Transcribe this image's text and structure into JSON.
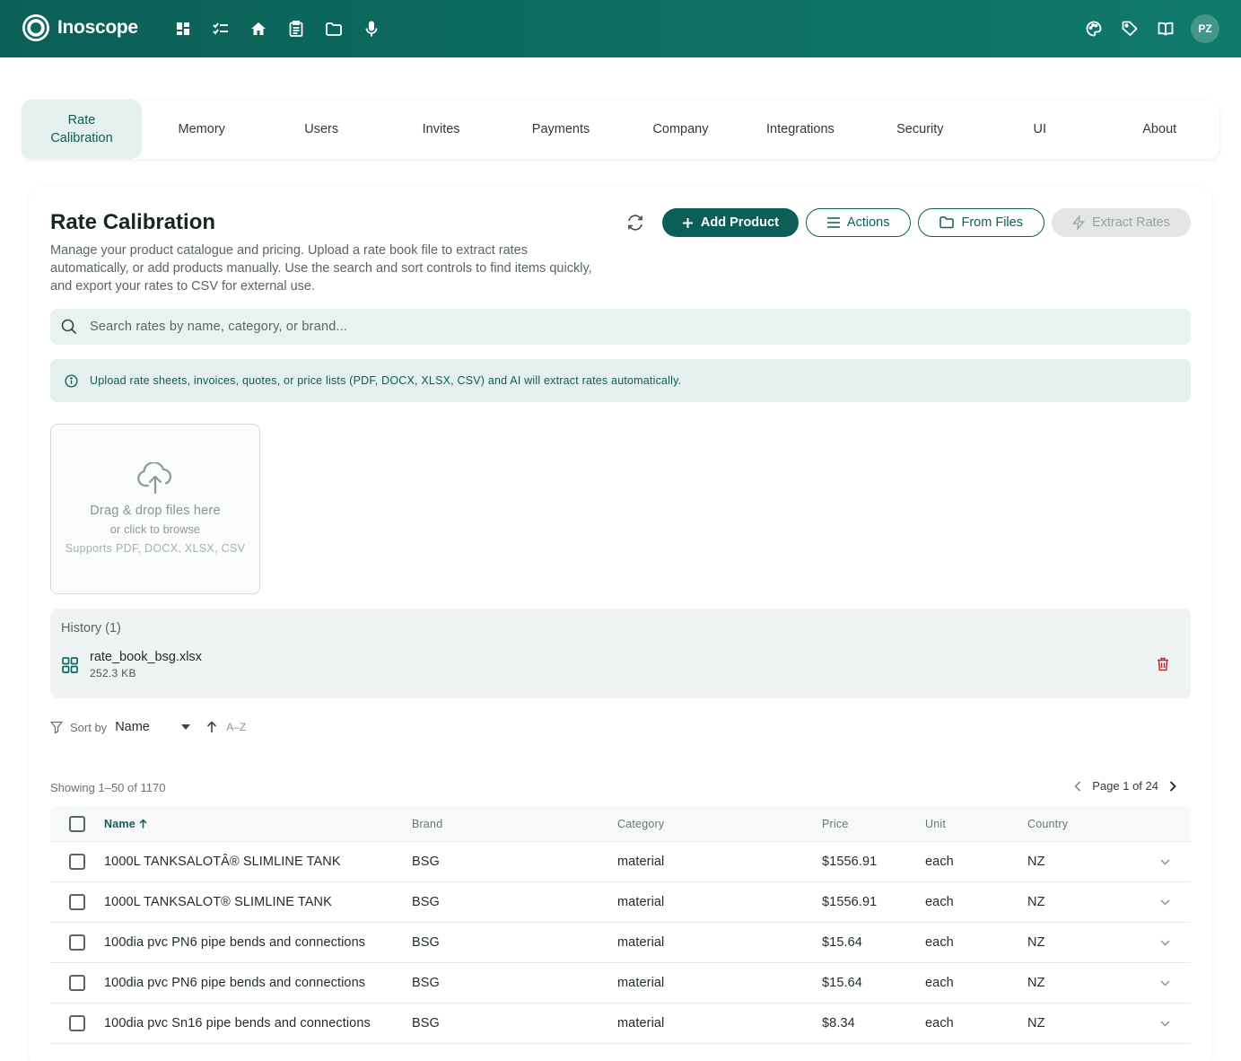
{
  "app": {
    "name": "Inoscope",
    "user_initials": "PZ",
    "accent_color": "#0b5f57",
    "nav_icons": [
      "dashboard-icon",
      "checklist-icon",
      "home-icon",
      "clipboard-icon",
      "folder-icon",
      "microphone-icon"
    ],
    "right_icons": [
      "palette-icon",
      "tag-icon",
      "book-icon"
    ]
  },
  "tabs": [
    {
      "label": "Rate Calibration",
      "active": true
    },
    {
      "label": "Memory"
    },
    {
      "label": "Users"
    },
    {
      "label": "Invites"
    },
    {
      "label": "Payments"
    },
    {
      "label": "Company"
    },
    {
      "label": "Integrations"
    },
    {
      "label": "Security"
    },
    {
      "label": "UI"
    },
    {
      "label": "About"
    }
  ],
  "page": {
    "title": "Rate Calibration",
    "description": "Manage your product catalogue and pricing. Upload a rate book file to extract rates automatically, or add products manually. Use the search and sort controls to find items quickly, and export your rates to CSV for external use."
  },
  "buttons": {
    "add_product": "Add Product",
    "actions": "Actions",
    "from_files": "From Files",
    "extract_rates": "Extract Rates"
  },
  "search": {
    "placeholder": "Search rates by name, category, or brand..."
  },
  "info_banner": "Upload rate sheets, invoices, quotes, or price lists (PDF, DOCX, XLSX, CSV) and AI will extract rates automatically.",
  "dropzone": {
    "title": "Drag & drop files here",
    "subtitle": "or click to browse",
    "supports": "Supports PDF, DOCX, XLSX, CSV"
  },
  "history": {
    "title": "History (1)",
    "files": [
      {
        "name": "rate_book_bsg.xlsx",
        "size": "252.3 KB"
      }
    ]
  },
  "sort": {
    "label": "Sort by",
    "field": "Name",
    "direction": "A–Z"
  },
  "pagination": {
    "showing": "Showing 1–50 of 1170",
    "page": "Page 1 of 24"
  },
  "table": {
    "headers": {
      "name": "Name",
      "brand": "Brand",
      "category": "Category",
      "price": "Price",
      "unit": "Unit",
      "country": "Country"
    },
    "rows": [
      {
        "name": "1000L TANKSALOTÂ® SLIMLINE TANK",
        "brand": "BSG",
        "category": "material",
        "price": "$1556.91",
        "unit": "each",
        "country": "NZ"
      },
      {
        "name": "1000L TANKSALOT® SLIMLINE TANK",
        "brand": "BSG",
        "category": "material",
        "price": "$1556.91",
        "unit": "each",
        "country": "NZ"
      },
      {
        "name": "100dia pvc PN6 pipe bends and connections",
        "brand": "BSG",
        "category": "material",
        "price": "$15.64",
        "unit": "each",
        "country": "NZ"
      },
      {
        "name": "100dia pvc PN6 pipe bends and connections",
        "brand": "BSG",
        "category": "material",
        "price": "$15.64",
        "unit": "each",
        "country": "NZ"
      },
      {
        "name": "100dia pvc Sn16 pipe bends and connections",
        "brand": "BSG",
        "category": "material",
        "price": "$8.34",
        "unit": "each",
        "country": "NZ"
      }
    ]
  }
}
